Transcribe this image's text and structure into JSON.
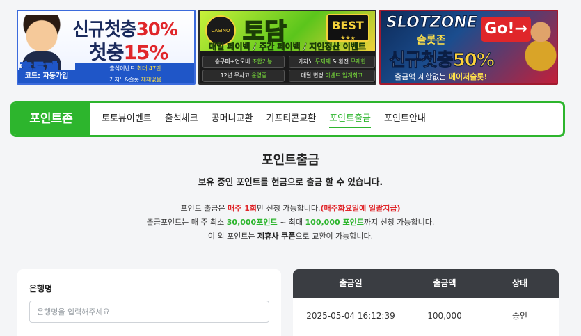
{
  "banners": {
    "b1": {
      "name": "홍두께",
      "code": "코드: 자동가입",
      "line1_prefix": "신규첫충",
      "line1_value": "30%",
      "line2_prefix": "첫충",
      "line2_value": "15%",
      "info1_a": "출석이벤트 ",
      "info1_b": "최대 47만",
      "info2_a": "카지노&슬롯 ",
      "info2_b": "제재없음"
    },
    "b2": {
      "logo": "CASINO SPORTS",
      "brand": "토담",
      "best": "BEST",
      "best_stars": "★★★",
      "slogan_a": "매일 ",
      "slogan_b": "페이백",
      "slogan_c": " / 주간 ",
      "slogan_d": "페이백",
      "slogan_e": " / 지인정산 ",
      "slogan_f": "이벤트",
      "c1_a": "승무패+언오버 ",
      "c1_b": "조합가능",
      "c2_a": "카지노 ",
      "c2_b": "무제재",
      "c2_c": " & 환전 ",
      "c2_d": "무제한",
      "c3_a": "12년 무사고 ",
      "c3_b": "운영중",
      "c4_a": "매달 변경 ",
      "c4_b": "이벤트 업계최고"
    },
    "b3": {
      "brand": "SLOTZONE",
      "brand_ko": "슬롯존",
      "go": "Go!→",
      "big_a": "신규첫충",
      "big_b": "50%",
      "sub_a": "출금액 제한없는 ",
      "sub_b": "메이저슬롯!"
    }
  },
  "nav": {
    "brand": "포인트존",
    "items": [
      "토토뷰이벤트",
      "출석체크",
      "공머니교환",
      "기프티콘교환",
      "포인트출금",
      "포인트안내"
    ],
    "active_index": 4
  },
  "page": {
    "title": "포인트출금",
    "subtitle": "보유 중인 포인트를 현금으로 출금 할 수 있습니다.",
    "note1_a": "포인트 출금은 ",
    "note1_b": "매주 1회",
    "note1_c": "만 신청 가능합니다.",
    "note1_d": "(매주화요일에 일괄지급)",
    "note2_a": "출금포인트는 매 주 최소 ",
    "note2_b": "30,000포인트",
    "note2_c": " ~ 최대 ",
    "note2_d": "100,000 포인트",
    "note2_e": "까지 신청 가능합니다.",
    "note3_a": "이 외 포인트는 ",
    "note3_b": "제휴사 쿠폰",
    "note3_c": "으로 교환이 가능합니다."
  },
  "form": {
    "bank_label": "은행명",
    "bank_placeholder": "은행명을 입력해주세요",
    "bank_value": ""
  },
  "history": {
    "headers": [
      "출금일",
      "출금액",
      "상태"
    ],
    "rows": [
      [
        "2025-05-04 16:12:39",
        "100,000",
        "승인"
      ]
    ]
  },
  "colors": {
    "accent": "#2db52d",
    "highlight_red": "#e0262a",
    "table_header": "#3a3d42"
  }
}
